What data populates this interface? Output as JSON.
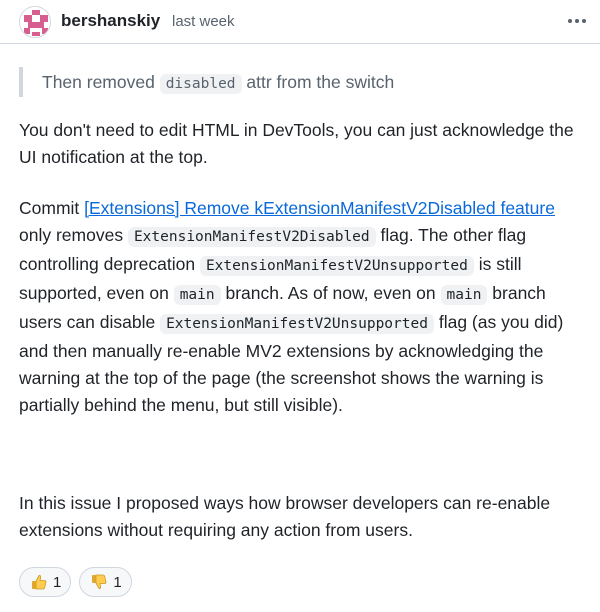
{
  "header": {
    "author": "bershanskiy",
    "timestamp": "last week",
    "menu_icon": "kebab-horizontal-icon",
    "avatar_color": "#d65f8f"
  },
  "quote": {
    "before": "Then removed ",
    "code": "disabled",
    "after": " attr from the switch"
  },
  "paragraph1": "You don't need to edit HTML in DevTools, you can just acknowledge the UI notification at the top.",
  "paragraph2": {
    "prefix": "Commit ",
    "link_text": "[Extensions] Remove kExtensionManifestV2Disabled feature",
    "t1": "only removes ",
    "c1": "ExtensionManifestV2Disabled",
    "t2": " flag. The other flag controlling deprecation ",
    "c2": "ExtensionManifestV2Unsupported",
    "t3": " is still supported, even on ",
    "c3": "main",
    "t4": " branch. As of now, even on ",
    "c4": "main",
    "t5": " branch users can disable ",
    "c5": "ExtensionManifestV2Unsupported",
    "t6": " flag (as you did) and then manually re-enable MV2 extensions by acknowledging the warning at the top of the page (the screenshot shows the warning is partially behind the menu, but still visible)."
  },
  "paragraph3": "In this issue I proposed ways how browser developers can re-enable extensions without requiring any action from users.",
  "reactions": [
    {
      "icon": "thumbs-up-icon",
      "count": "1"
    },
    {
      "icon": "thumbs-down-icon",
      "count": "1"
    }
  ],
  "colors": {
    "link": "#0969da",
    "muted": "#59636e",
    "border": "#d0d7de",
    "code_bg": "#eff1f3"
  }
}
